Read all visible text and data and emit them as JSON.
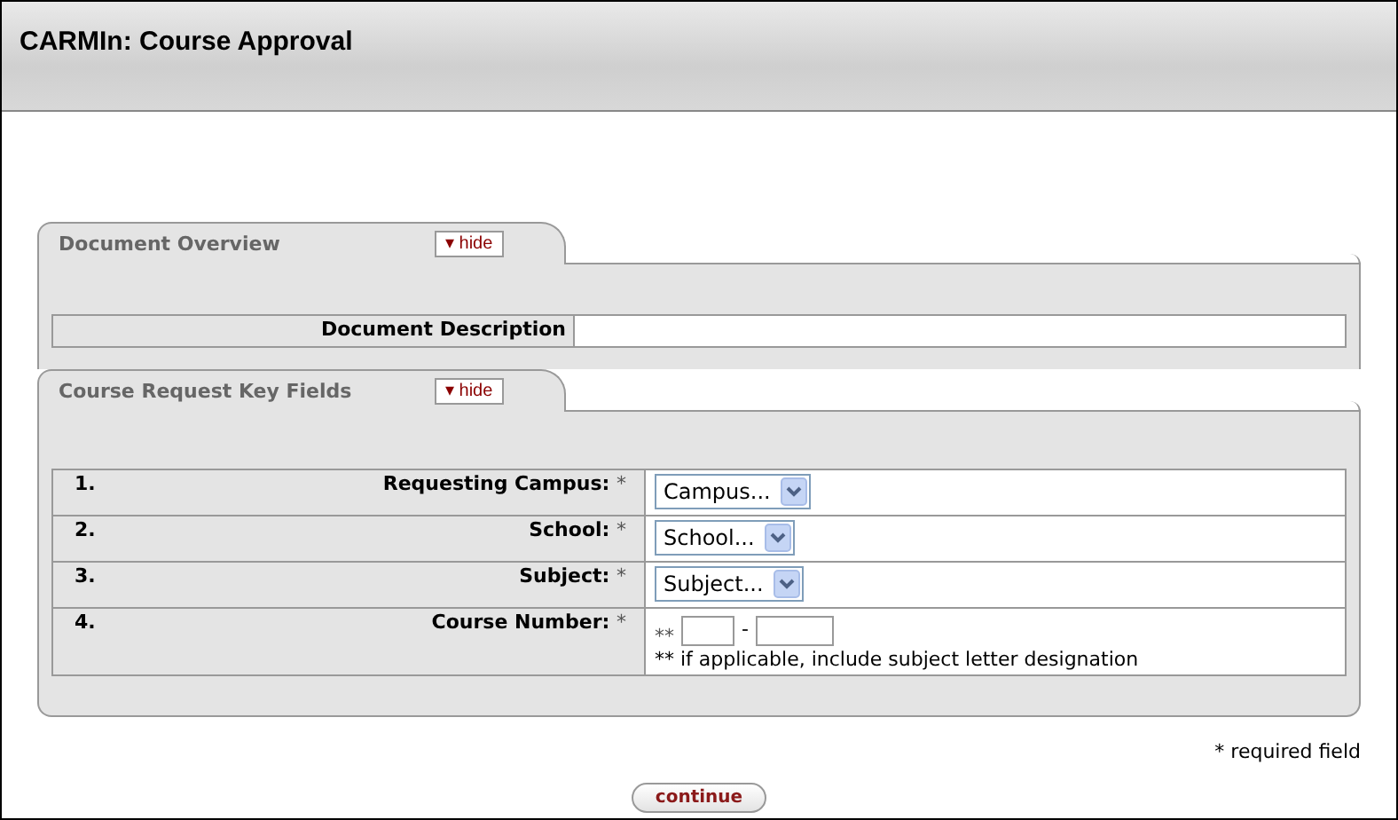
{
  "window": {
    "title": "CARMIn: Course Approval"
  },
  "document_overview": {
    "title": "Document Overview",
    "toggle": {
      "arrow": "▾",
      "label": "hide"
    },
    "fields": [
      {
        "label": "Document Description"
      }
    ]
  },
  "key_fields": {
    "title": "Course Request Key Fields",
    "toggle": {
      "arrow": "▾",
      "label": "hide"
    },
    "rows": [
      {
        "number": "1.",
        "label": "Requesting Campus:",
        "marker": "*",
        "kind": "select",
        "value": "Campus..."
      },
      {
        "number": "2.",
        "label": "School:",
        "marker": "*",
        "kind": "select",
        "value": "School..."
      },
      {
        "number": "3.",
        "label": "Subject:",
        "marker": "*",
        "kind": "select",
        "value": "Subject..."
      },
      {
        "number": "4.",
        "label": "Course Number:",
        "marker": "*",
        "kind": "course-number",
        "prefix": "**",
        "separator": "-",
        "note": "** if applicable, include subject letter designation"
      }
    ]
  },
  "footer": {
    "required_note": "* required field",
    "button": "continue"
  }
}
